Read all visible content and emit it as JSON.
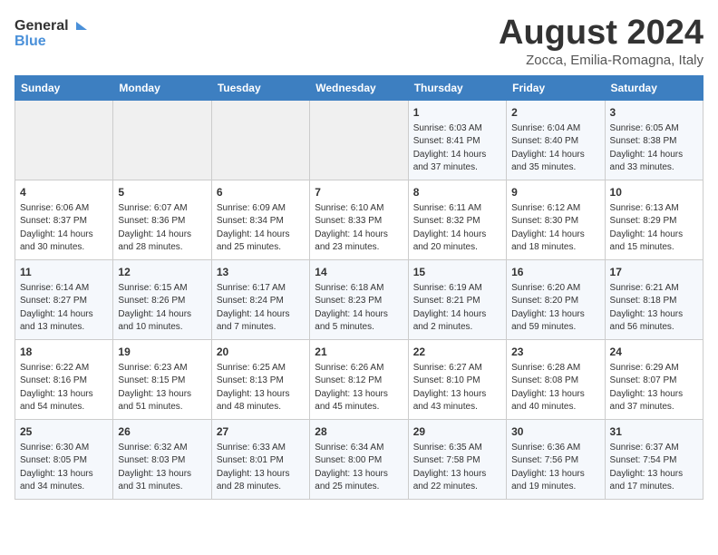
{
  "header": {
    "logo_general": "General",
    "logo_blue": "Blue",
    "month_title": "August 2024",
    "location": "Zocca, Emilia-Romagna, Italy"
  },
  "days_of_week": [
    "Sunday",
    "Monday",
    "Tuesday",
    "Wednesday",
    "Thursday",
    "Friday",
    "Saturday"
  ],
  "weeks": [
    [
      {
        "day": "",
        "info": ""
      },
      {
        "day": "",
        "info": ""
      },
      {
        "day": "",
        "info": ""
      },
      {
        "day": "",
        "info": ""
      },
      {
        "day": "1",
        "info": "Sunrise: 6:03 AM\nSunset: 8:41 PM\nDaylight: 14 hours\nand 37 minutes."
      },
      {
        "day": "2",
        "info": "Sunrise: 6:04 AM\nSunset: 8:40 PM\nDaylight: 14 hours\nand 35 minutes."
      },
      {
        "day": "3",
        "info": "Sunrise: 6:05 AM\nSunset: 8:38 PM\nDaylight: 14 hours\nand 33 minutes."
      }
    ],
    [
      {
        "day": "4",
        "info": "Sunrise: 6:06 AM\nSunset: 8:37 PM\nDaylight: 14 hours\nand 30 minutes."
      },
      {
        "day": "5",
        "info": "Sunrise: 6:07 AM\nSunset: 8:36 PM\nDaylight: 14 hours\nand 28 minutes."
      },
      {
        "day": "6",
        "info": "Sunrise: 6:09 AM\nSunset: 8:34 PM\nDaylight: 14 hours\nand 25 minutes."
      },
      {
        "day": "7",
        "info": "Sunrise: 6:10 AM\nSunset: 8:33 PM\nDaylight: 14 hours\nand 23 minutes."
      },
      {
        "day": "8",
        "info": "Sunrise: 6:11 AM\nSunset: 8:32 PM\nDaylight: 14 hours\nand 20 minutes."
      },
      {
        "day": "9",
        "info": "Sunrise: 6:12 AM\nSunset: 8:30 PM\nDaylight: 14 hours\nand 18 minutes."
      },
      {
        "day": "10",
        "info": "Sunrise: 6:13 AM\nSunset: 8:29 PM\nDaylight: 14 hours\nand 15 minutes."
      }
    ],
    [
      {
        "day": "11",
        "info": "Sunrise: 6:14 AM\nSunset: 8:27 PM\nDaylight: 14 hours\nand 13 minutes."
      },
      {
        "day": "12",
        "info": "Sunrise: 6:15 AM\nSunset: 8:26 PM\nDaylight: 14 hours\nand 10 minutes."
      },
      {
        "day": "13",
        "info": "Sunrise: 6:17 AM\nSunset: 8:24 PM\nDaylight: 14 hours\nand 7 minutes."
      },
      {
        "day": "14",
        "info": "Sunrise: 6:18 AM\nSunset: 8:23 PM\nDaylight: 14 hours\nand 5 minutes."
      },
      {
        "day": "15",
        "info": "Sunrise: 6:19 AM\nSunset: 8:21 PM\nDaylight: 14 hours\nand 2 minutes."
      },
      {
        "day": "16",
        "info": "Sunrise: 6:20 AM\nSunset: 8:20 PM\nDaylight: 13 hours\nand 59 minutes."
      },
      {
        "day": "17",
        "info": "Sunrise: 6:21 AM\nSunset: 8:18 PM\nDaylight: 13 hours\nand 56 minutes."
      }
    ],
    [
      {
        "day": "18",
        "info": "Sunrise: 6:22 AM\nSunset: 8:16 PM\nDaylight: 13 hours\nand 54 minutes."
      },
      {
        "day": "19",
        "info": "Sunrise: 6:23 AM\nSunset: 8:15 PM\nDaylight: 13 hours\nand 51 minutes."
      },
      {
        "day": "20",
        "info": "Sunrise: 6:25 AM\nSunset: 8:13 PM\nDaylight: 13 hours\nand 48 minutes."
      },
      {
        "day": "21",
        "info": "Sunrise: 6:26 AM\nSunset: 8:12 PM\nDaylight: 13 hours\nand 45 minutes."
      },
      {
        "day": "22",
        "info": "Sunrise: 6:27 AM\nSunset: 8:10 PM\nDaylight: 13 hours\nand 43 minutes."
      },
      {
        "day": "23",
        "info": "Sunrise: 6:28 AM\nSunset: 8:08 PM\nDaylight: 13 hours\nand 40 minutes."
      },
      {
        "day": "24",
        "info": "Sunrise: 6:29 AM\nSunset: 8:07 PM\nDaylight: 13 hours\nand 37 minutes."
      }
    ],
    [
      {
        "day": "25",
        "info": "Sunrise: 6:30 AM\nSunset: 8:05 PM\nDaylight: 13 hours\nand 34 minutes."
      },
      {
        "day": "26",
        "info": "Sunrise: 6:32 AM\nSunset: 8:03 PM\nDaylight: 13 hours\nand 31 minutes."
      },
      {
        "day": "27",
        "info": "Sunrise: 6:33 AM\nSunset: 8:01 PM\nDaylight: 13 hours\nand 28 minutes."
      },
      {
        "day": "28",
        "info": "Sunrise: 6:34 AM\nSunset: 8:00 PM\nDaylight: 13 hours\nand 25 minutes."
      },
      {
        "day": "29",
        "info": "Sunrise: 6:35 AM\nSunset: 7:58 PM\nDaylight: 13 hours\nand 22 minutes."
      },
      {
        "day": "30",
        "info": "Sunrise: 6:36 AM\nSunset: 7:56 PM\nDaylight: 13 hours\nand 19 minutes."
      },
      {
        "day": "31",
        "info": "Sunrise: 6:37 AM\nSunset: 7:54 PM\nDaylight: 13 hours\nand 17 minutes."
      }
    ]
  ]
}
